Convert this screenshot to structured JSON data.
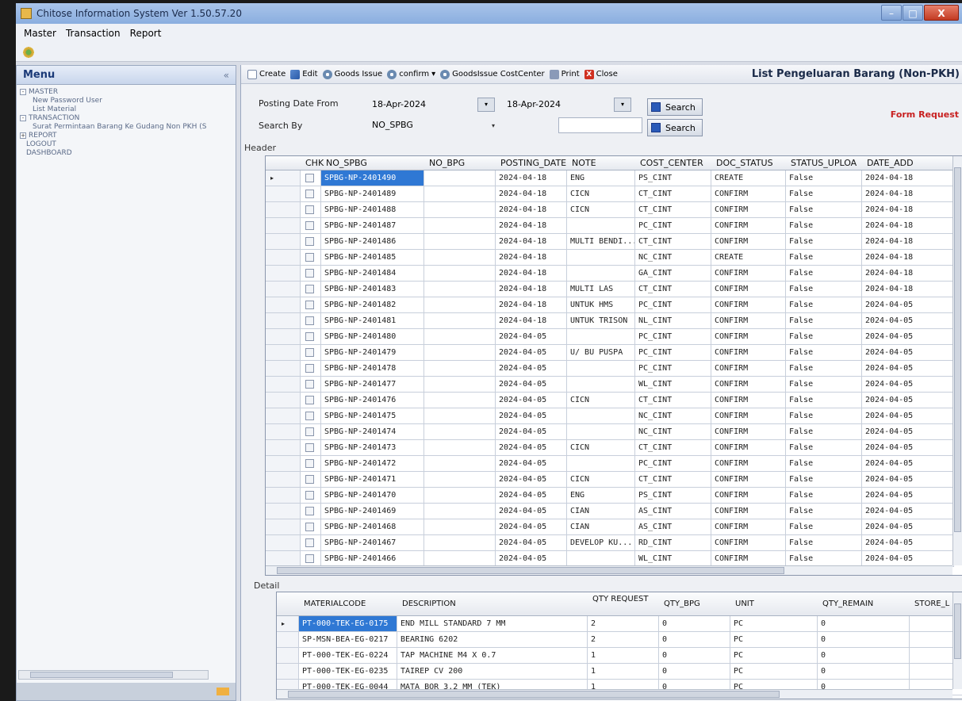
{
  "window": {
    "title": "Chitose Information System Ver 1.50.57.20",
    "min": "–",
    "max": "□",
    "close": "X"
  },
  "menubar": {
    "items": [
      "Master",
      "Transaction",
      "Report"
    ]
  },
  "leftmenu": {
    "title": "Menu",
    "collapse": "«",
    "tree": [
      {
        "label": "MASTER",
        "type": "group",
        "exp": "-"
      },
      {
        "label": "New Password User",
        "type": "leaf"
      },
      {
        "label": "List Material",
        "type": "leaf"
      },
      {
        "label": "TRANSACTION",
        "type": "group",
        "exp": "-"
      },
      {
        "label": "Surat Permintaan Barang Ke Gudang Non PKH (S",
        "type": "leaf"
      },
      {
        "label": "REPORT",
        "type": "group",
        "exp": "+"
      },
      {
        "label": "LOGOUT",
        "type": "top"
      },
      {
        "label": "DASHBOARD",
        "type": "top"
      }
    ]
  },
  "toolbar": {
    "create": "Create",
    "edit": "Edit",
    "goods_issue": "Goods Issue",
    "confirm": "confirm",
    "confirm_dd": "▾",
    "goods_issue_cost_center": "GoodsIssue CostCenter",
    "print": "Print",
    "close": "Close",
    "close_icon": "X"
  },
  "page_title": "List Pengeluaran Barang (Non-PKH)",
  "form_request": "Form Request",
  "filters": {
    "posting_date_label": "Posting Date From",
    "date_from": "18-Apr-2024",
    "date_to": "18-Apr-2024",
    "date_btn": "▾",
    "search_by_label": "Search By",
    "search_by_value": "NO_SPBG",
    "search_by_arrow": "▾",
    "search_text": "",
    "search_btn_label": "Search"
  },
  "header_section_label": "Header",
  "header_grid": {
    "columns": [
      "CHK",
      "NO_SPBG",
      "NO_BPG",
      "POSTING_DATE",
      "NOTE",
      "COST_CENTER",
      "DOC_STATUS",
      "STATUS_UPLOA",
      "DATE_ADD"
    ],
    "pointer": "▸",
    "rows": [
      {
        "no_spbg": "SPBG-NP-2401490",
        "no_bpg": "",
        "posting_date": "2024-04-18",
        "note": "ENG",
        "cost_center": "PS_CINT",
        "doc_status": "CREATE",
        "status_upload": "False",
        "date_add": "2024-04-18"
      },
      {
        "no_spbg": "SPBG-NP-2401489",
        "no_bpg": "",
        "posting_date": "2024-04-18",
        "note": "CICN",
        "cost_center": "CT_CINT",
        "doc_status": "CONFIRM",
        "status_upload": "False",
        "date_add": "2024-04-18"
      },
      {
        "no_spbg": "SPBG-NP-2401488",
        "no_bpg": "",
        "posting_date": "2024-04-18",
        "note": "CICN",
        "cost_center": "CT_CINT",
        "doc_status": "CONFIRM",
        "status_upload": "False",
        "date_add": "2024-04-18"
      },
      {
        "no_spbg": "SPBG-NP-2401487",
        "no_bpg": "",
        "posting_date": "2024-04-18",
        "note": "",
        "cost_center": "PC_CINT",
        "doc_status": "CONFIRM",
        "status_upload": "False",
        "date_add": "2024-04-18"
      },
      {
        "no_spbg": "SPBG-NP-2401486",
        "no_bpg": "",
        "posting_date": "2024-04-18",
        "note": "MULTI BENDI...",
        "cost_center": "CT_CINT",
        "doc_status": "CONFIRM",
        "status_upload": "False",
        "date_add": "2024-04-18"
      },
      {
        "no_spbg": "SPBG-NP-2401485",
        "no_bpg": "",
        "posting_date": "2024-04-18",
        "note": "",
        "cost_center": "NC_CINT",
        "doc_status": "CREATE",
        "status_upload": "False",
        "date_add": "2024-04-18"
      },
      {
        "no_spbg": "SPBG-NP-2401484",
        "no_bpg": "",
        "posting_date": "2024-04-18",
        "note": "",
        "cost_center": "GA_CINT",
        "doc_status": "CONFIRM",
        "status_upload": "False",
        "date_add": "2024-04-18"
      },
      {
        "no_spbg": "SPBG-NP-2401483",
        "no_bpg": "",
        "posting_date": "2024-04-18",
        "note": "MULTI LAS",
        "cost_center": "CT_CINT",
        "doc_status": "CONFIRM",
        "status_upload": "False",
        "date_add": "2024-04-18"
      },
      {
        "no_spbg": "SPBG-NP-2401482",
        "no_bpg": "",
        "posting_date": "2024-04-18",
        "note": "UNTUK HMS",
        "cost_center": "PC_CINT",
        "doc_status": "CONFIRM",
        "status_upload": "False",
        "date_add": "2024-04-05"
      },
      {
        "no_spbg": "SPBG-NP-2401481",
        "no_bpg": "",
        "posting_date": "2024-04-18",
        "note": "UNTUK TRISON",
        "cost_center": "NL_CINT",
        "doc_status": "CONFIRM",
        "status_upload": "False",
        "date_add": "2024-04-05"
      },
      {
        "no_spbg": "SPBG-NP-2401480",
        "no_bpg": "",
        "posting_date": "2024-04-05",
        "note": "",
        "cost_center": "PC_CINT",
        "doc_status": "CONFIRM",
        "status_upload": "False",
        "date_add": "2024-04-05"
      },
      {
        "no_spbg": "SPBG-NP-2401479",
        "no_bpg": "",
        "posting_date": "2024-04-05",
        "note": "U/ BU PUSPA",
        "cost_center": "PC_CINT",
        "doc_status": "CONFIRM",
        "status_upload": "False",
        "date_add": "2024-04-05"
      },
      {
        "no_spbg": "SPBG-NP-2401478",
        "no_bpg": "",
        "posting_date": "2024-04-05",
        "note": "",
        "cost_center": "PC_CINT",
        "doc_status": "CONFIRM",
        "status_upload": "False",
        "date_add": "2024-04-05"
      },
      {
        "no_spbg": "SPBG-NP-2401477",
        "no_bpg": "",
        "posting_date": "2024-04-05",
        "note": "",
        "cost_center": "WL_CINT",
        "doc_status": "CONFIRM",
        "status_upload": "False",
        "date_add": "2024-04-05"
      },
      {
        "no_spbg": "SPBG-NP-2401476",
        "no_bpg": "",
        "posting_date": "2024-04-05",
        "note": "CICN",
        "cost_center": "CT_CINT",
        "doc_status": "CONFIRM",
        "status_upload": "False",
        "date_add": "2024-04-05"
      },
      {
        "no_spbg": "SPBG-NP-2401475",
        "no_bpg": "",
        "posting_date": "2024-04-05",
        "note": "",
        "cost_center": "NC_CINT",
        "doc_status": "CONFIRM",
        "status_upload": "False",
        "date_add": "2024-04-05"
      },
      {
        "no_spbg": "SPBG-NP-2401474",
        "no_bpg": "",
        "posting_date": "2024-04-05",
        "note": "",
        "cost_center": "NC_CINT",
        "doc_status": "CONFIRM",
        "status_upload": "False",
        "date_add": "2024-04-05"
      },
      {
        "no_spbg": "SPBG-NP-2401473",
        "no_bpg": "",
        "posting_date": "2024-04-05",
        "note": "CICN",
        "cost_center": "CT_CINT",
        "doc_status": "CONFIRM",
        "status_upload": "False",
        "date_add": "2024-04-05"
      },
      {
        "no_spbg": "SPBG-NP-2401472",
        "no_bpg": "",
        "posting_date": "2024-04-05",
        "note": "",
        "cost_center": "PC_CINT",
        "doc_status": "CONFIRM",
        "status_upload": "False",
        "date_add": "2024-04-05"
      },
      {
        "no_spbg": "SPBG-NP-2401471",
        "no_bpg": "",
        "posting_date": "2024-04-05",
        "note": "CICN",
        "cost_center": "CT_CINT",
        "doc_status": "CONFIRM",
        "status_upload": "False",
        "date_add": "2024-04-05"
      },
      {
        "no_spbg": "SPBG-NP-2401470",
        "no_bpg": "",
        "posting_date": "2024-04-05",
        "note": "ENG",
        "cost_center": "PS_CINT",
        "doc_status": "CONFIRM",
        "status_upload": "False",
        "date_add": "2024-04-05"
      },
      {
        "no_spbg": "SPBG-NP-2401469",
        "no_bpg": "",
        "posting_date": "2024-04-05",
        "note": "CIAN",
        "cost_center": "AS_CINT",
        "doc_status": "CONFIRM",
        "status_upload": "False",
        "date_add": "2024-04-05"
      },
      {
        "no_spbg": "SPBG-NP-2401468",
        "no_bpg": "",
        "posting_date": "2024-04-05",
        "note": "CIAN",
        "cost_center": "AS_CINT",
        "doc_status": "CONFIRM",
        "status_upload": "False",
        "date_add": "2024-04-05"
      },
      {
        "no_spbg": "SPBG-NP-2401467",
        "no_bpg": "",
        "posting_date": "2024-04-05",
        "note": "DEVELOP KU...",
        "cost_center": "RD_CINT",
        "doc_status": "CONFIRM",
        "status_upload": "False",
        "date_add": "2024-04-05"
      },
      {
        "no_spbg": "SPBG-NP-2401466",
        "no_bpg": "",
        "posting_date": "2024-04-05",
        "note": "",
        "cost_center": "WL_CINT",
        "doc_status": "CONFIRM",
        "status_upload": "False",
        "date_add": "2024-04-05"
      }
    ]
  },
  "detail_section_label": "Detail",
  "detail_grid": {
    "columns": [
      "MATERIALCODE",
      "DESCRIPTION",
      "QTY REQUEST",
      "QTY_BPG",
      "UNIT",
      "QTY_REMAIN",
      "STORE_L"
    ],
    "pointer": "▸",
    "rows": [
      {
        "materialcode": "PT-000-TEK-EG-0175",
        "description": "END MILL STANDARD 7 MM",
        "qty_request": "2",
        "qty_bpg": "0",
        "unit": "PC",
        "qty_remain": "0",
        "store": ""
      },
      {
        "materialcode": "SP-MSN-BEA-EG-0217",
        "description": "BEARING 6202",
        "qty_request": "2",
        "qty_bpg": "0",
        "unit": "PC",
        "qty_remain": "0",
        "store": ""
      },
      {
        "materialcode": "PT-000-TEK-EG-0224",
        "description": "TAP MACHINE M4 X 0.7",
        "qty_request": "1",
        "qty_bpg": "0",
        "unit": "PC",
        "qty_remain": "0",
        "store": ""
      },
      {
        "materialcode": "PT-000-TEK-EG-0235",
        "description": "TAIREP CV 200",
        "qty_request": "1",
        "qty_bpg": "0",
        "unit": "PC",
        "qty_remain": "0",
        "store": ""
      },
      {
        "materialcode": "PT-000-TEK-EG-0044",
        "description": "MATA BOR 3.2 MM (TEK)",
        "qty_request": "1",
        "qty_bpg": "0",
        "unit": "PC",
        "qty_remain": "0",
        "store": ""
      }
    ]
  },
  "colors": {
    "selection": "#2f78d4",
    "form_request": "#c82020",
    "menu_title": "#1b3a78"
  }
}
